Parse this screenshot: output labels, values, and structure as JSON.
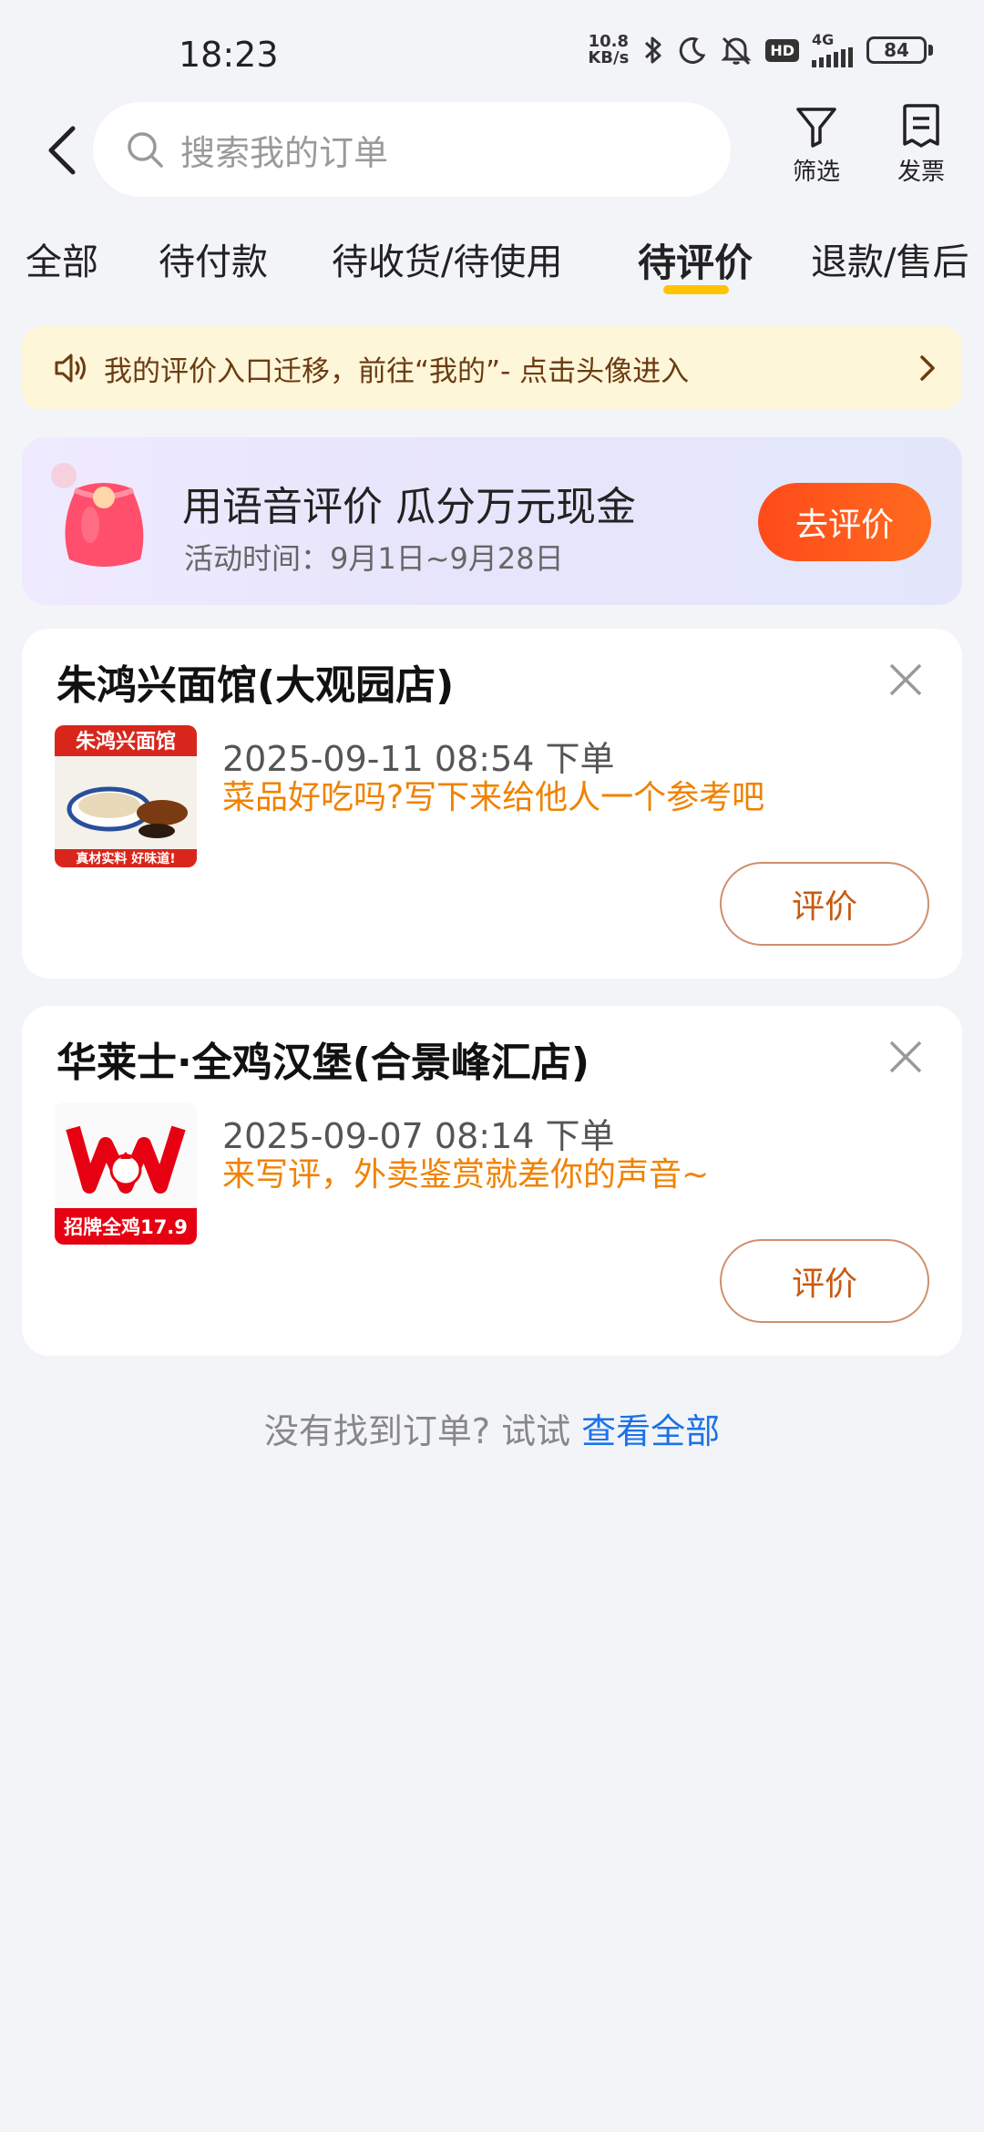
{
  "status_bar": {
    "time": "18:23",
    "net_speed_value": "10.8",
    "net_speed_unit": "KB/s",
    "network": "4G",
    "hd": "HD",
    "battery": "84"
  },
  "header": {
    "search_placeholder": "搜索我的订单",
    "filter_label": "筛选",
    "invoice_label": "发票"
  },
  "tabs": [
    {
      "label": "全部",
      "active": false
    },
    {
      "label": "待付款",
      "active": false
    },
    {
      "label": "待收货/待使用",
      "active": false
    },
    {
      "label": "待评价",
      "active": true
    },
    {
      "label": "退款/售后",
      "active": false
    }
  ],
  "notice": {
    "text": "我的评价入口迁移，前往“我的”- 点击头像进入"
  },
  "promo": {
    "title": "用语音评价 瓜分万元现金",
    "subtitle": "活动时间：9月1日~9月28日",
    "button": "去评价"
  },
  "orders": [
    {
      "store": "朱鸿兴面馆(大观园店)",
      "time": "2025-09-11 08:54 下单",
      "hint": "菜品好吃吗?写下来给他人一个参考吧",
      "button": "评价",
      "image_text_top": "朱鸿兴面馆",
      "image_text_bottom": "真材实料 好味道!"
    },
    {
      "store": "华莱士·全鸡汉堡(合景峰汇店)",
      "time": "2025-09-07 08:14 下单",
      "hint": "来写评，外卖鉴赏就差你的声音~",
      "button": "评价",
      "image_text_bottom": "招牌全鸡17.9"
    }
  ],
  "footer": {
    "text": "没有找到订单? 试试 ",
    "link": "查看全部"
  },
  "colors": {
    "accent_yellow": "#ffc300",
    "orange_hint": "#f08200",
    "promo_button": "#ff4a1a",
    "link_blue": "#1a73e8"
  }
}
